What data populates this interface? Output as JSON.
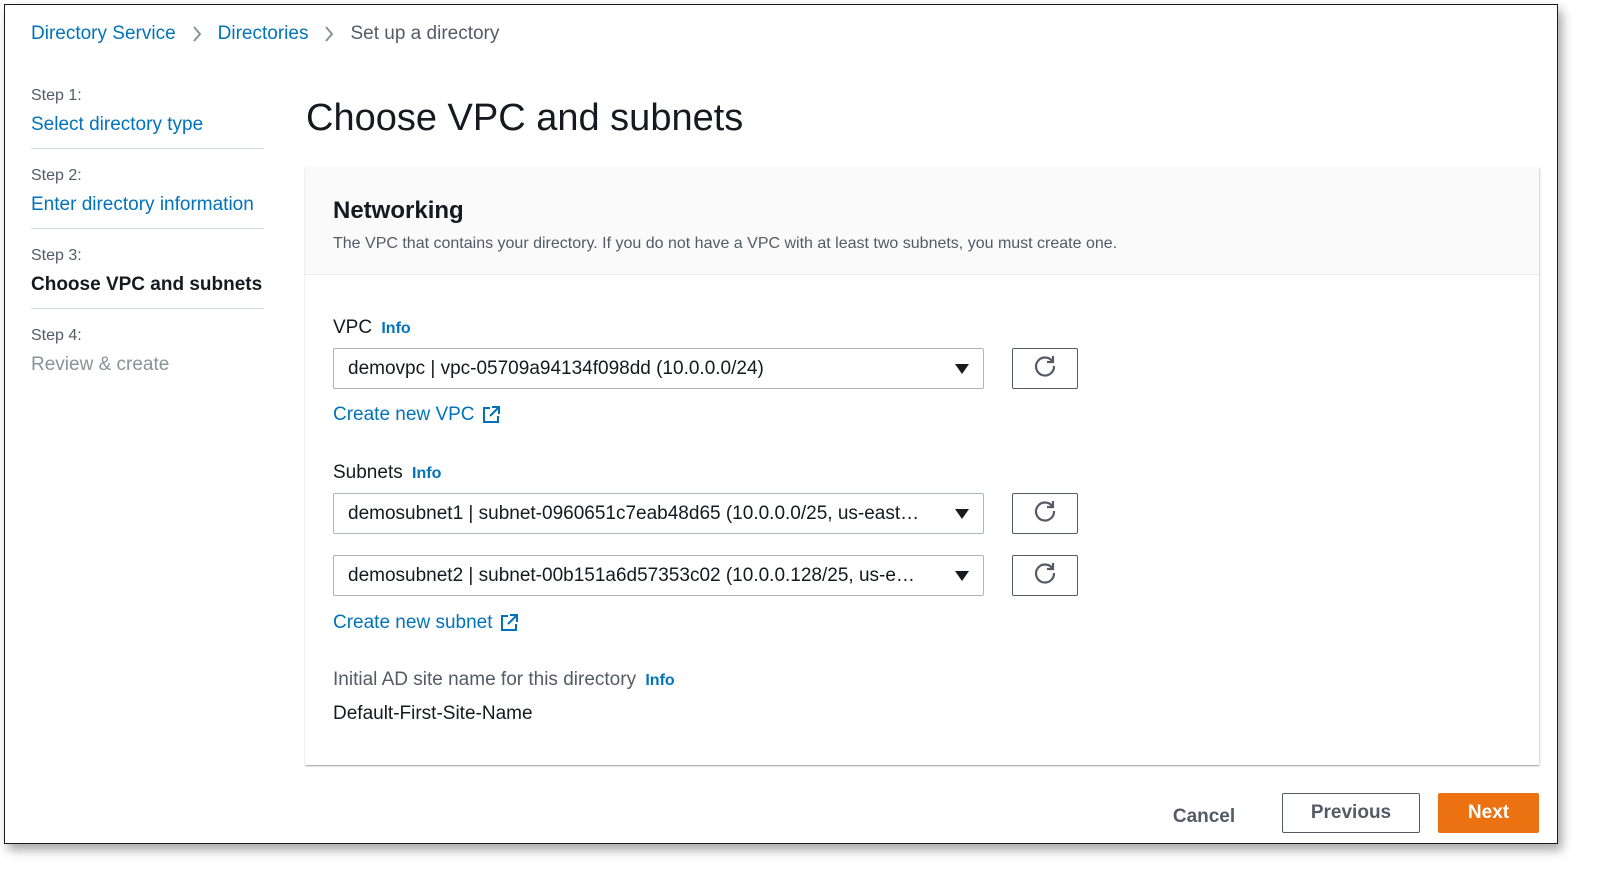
{
  "breadcrumb": {
    "items": [
      {
        "label": "Directory Service"
      },
      {
        "label": "Directories"
      },
      {
        "label": "Set up a directory"
      }
    ]
  },
  "steps": [
    {
      "number": "Step 1:",
      "label": "Select directory type",
      "state": "link"
    },
    {
      "number": "Step 2:",
      "label": "Enter directory information",
      "state": "link"
    },
    {
      "number": "Step 3:",
      "label": "Choose VPC and subnets",
      "state": "active"
    },
    {
      "number": "Step 4:",
      "label": "Review & create",
      "state": "disabled"
    }
  ],
  "page_title": "Choose VPC and subnets",
  "networking": {
    "title": "Networking",
    "description": "The VPC that contains your directory. If you do not have a VPC with at least two subnets, you must create one.",
    "vpc": {
      "label": "VPC",
      "info": "Info",
      "selected": "demovpc | vpc-05709a94134f098dd (10.0.0.0/24)",
      "create_link": "Create new VPC"
    },
    "subnets": {
      "label": "Subnets",
      "info": "Info",
      "selected_1": "demosubnet1 | subnet-0960651c7eab48d65 (10.0.0.0/25, us-east…",
      "selected_2": "demosubnet2 | subnet-00b151a6d57353c02 (10.0.0.128/25, us-e…",
      "create_link": "Create new subnet"
    },
    "ad_site": {
      "label": "Initial AD site name for this directory",
      "info": "Info",
      "value": "Default-First-Site-Name"
    }
  },
  "footer": {
    "cancel": "Cancel",
    "previous": "Previous",
    "next": "Next"
  },
  "colors": {
    "link": "#0073bb",
    "primary_button": "#ec7211",
    "text": "#16191f",
    "muted": "#545b64"
  }
}
